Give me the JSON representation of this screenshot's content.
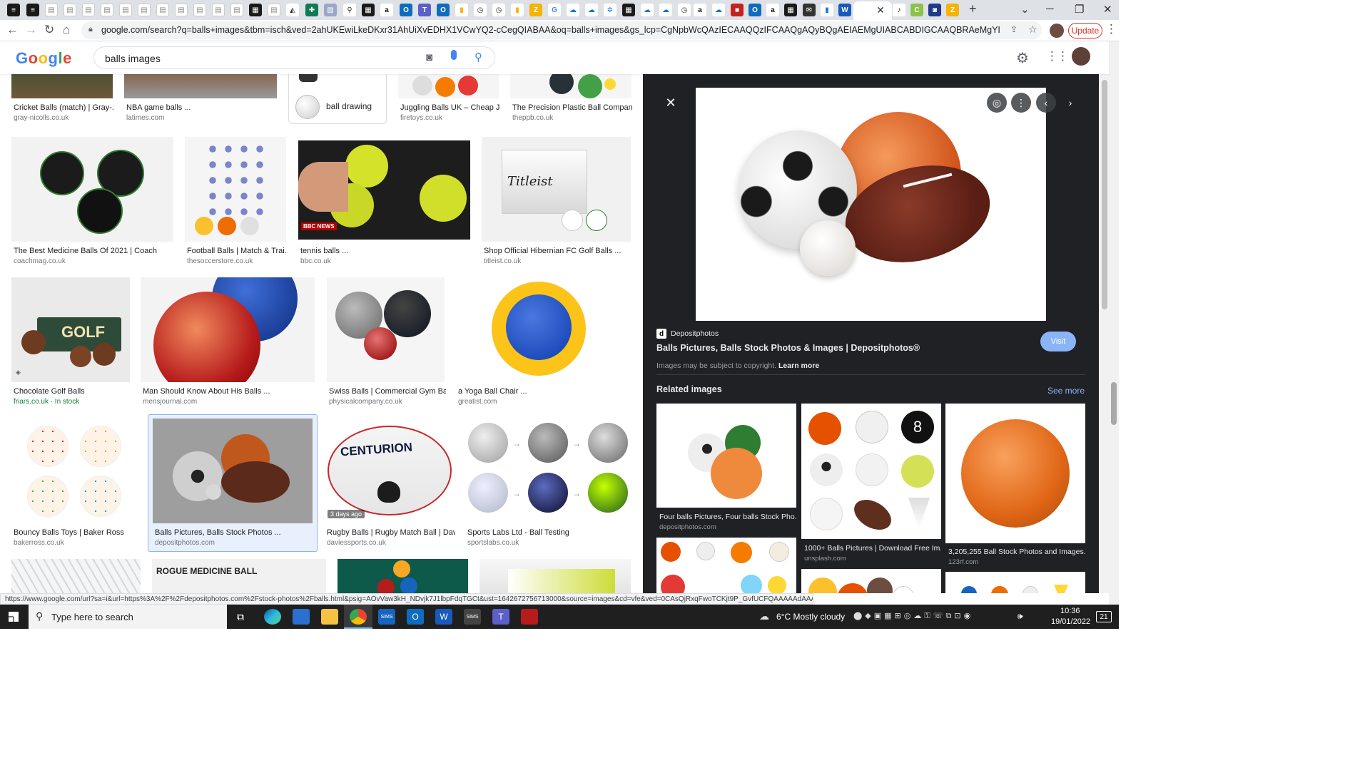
{
  "browser": {
    "url": "google.com/search?q=balls+images&tbm=isch&ved=2ahUKEwiLkeDKxr31AhUiXvEDHX1VCwYQ2-cCegQIABAA&oq=balls+images&gs_lcp=CgNpbWcQAzIECAAQQzIFCAAQgAQyBQgAEIAEMgUIABCABDIGCAAQBRAeMgYIABAFEB4yBggAEAUQHjIGC...",
    "update_label": "Update",
    "status_url": "https://www.google.com/url?sa=i&url=https%3A%2F%2Fdepositphotos.com%2Fstock-photos%2Fballs.html&psig=AOvVaw3kH_NDvjk7J1lbpFdqTGCt&ust=1642672756713000&source=images&cd=vfe&ved=0CAsQjRxqFwoTCKjt9P_GvfUCFQAAAAAdAAAAABAG"
  },
  "google": {
    "logo": "Google",
    "query": "balls images"
  },
  "chips": [
    {
      "label": "ball drawing"
    }
  ],
  "results": [
    {
      "title": "Cricket Balls (match) | Gray-...",
      "source": "gray-nicolls.co.uk"
    },
    {
      "title": "NBA game balls ...",
      "source": "latimes.com"
    },
    {
      "title": "Juggling Balls UK – Cheap J...",
      "source": "firetoys.co.uk"
    },
    {
      "title": "The Precision Plastic Ball Compan...",
      "source": "theppb.co.uk"
    },
    {
      "title": "The Best Medicine Balls Of 2021 | Coach",
      "source": "coachmag.co.uk"
    },
    {
      "title": "Football Balls | Match & Trai...",
      "source": "thesoccerstore.co.uk"
    },
    {
      "title": "tennis balls ...",
      "source": "bbc.co.uk"
    },
    {
      "title": "Shop Official Hibernian FC Golf Balls ...",
      "source": "titleist.co.uk"
    },
    {
      "title": "Chocolate Golf Balls",
      "source": "friars.co.uk · In stock"
    },
    {
      "title": "Man Should Know About His Balls ...",
      "source": "mensjournal.com"
    },
    {
      "title": "Swiss Balls | Commercial Gym Ba...",
      "source": "physicalcompany.co.uk"
    },
    {
      "title": "a Yoga Ball Chair ...",
      "source": "greatist.com"
    },
    {
      "title": "Bouncy Balls Toys | Baker Ross",
      "source": "bakerross.co.uk"
    },
    {
      "title": "Balls Pictures, Balls Stock Photos ...",
      "source": "depositphotos.com"
    },
    {
      "title": "Rugby Balls | Rugby Match Ball | Davi...",
      "source": "daviessports.co.uk"
    },
    {
      "title": "Sports Labs Ltd - Ball Testing",
      "source": "sportslabs.co.uk"
    }
  ],
  "thumb_text": {
    "bbc": "BBC NEWS",
    "titleist": "Titleist",
    "golf": "GOLF",
    "centurion": "CENTURION",
    "rogue": "ROGUE MEDICINE BALL",
    "days_ago": "3 days ago"
  },
  "preview": {
    "source": "Depositphotos",
    "title": "Balls Pictures, Balls Stock Photos & Images | Depositphotos®",
    "copyright": "Images may be subject to copyright.",
    "learn_more": "Learn more",
    "visit_label": "Visit",
    "related_heading": "Related images",
    "see_more": "See more",
    "related": [
      {
        "title": "Four balls Pictures, Four balls Stock Pho...",
        "source": "depositphotos.com"
      },
      {
        "title": "1000+ Balls Pictures | Download Free Im...",
        "source": "unsplash.com"
      },
      {
        "title": "3,205,255 Ball Stock Photos and Images...",
        "source": "123rf.com"
      }
    ]
  },
  "taskbar": {
    "search_placeholder": "Type here to search",
    "weather": "6°C  Mostly cloudy",
    "time": "10:36",
    "date": "19/01/2022",
    "notifications": "21"
  },
  "colors": {
    "accent": "#1a73e8",
    "visit_button": "#8ab4f8",
    "panel_bg": "#202124",
    "update_red": "#d93025"
  }
}
